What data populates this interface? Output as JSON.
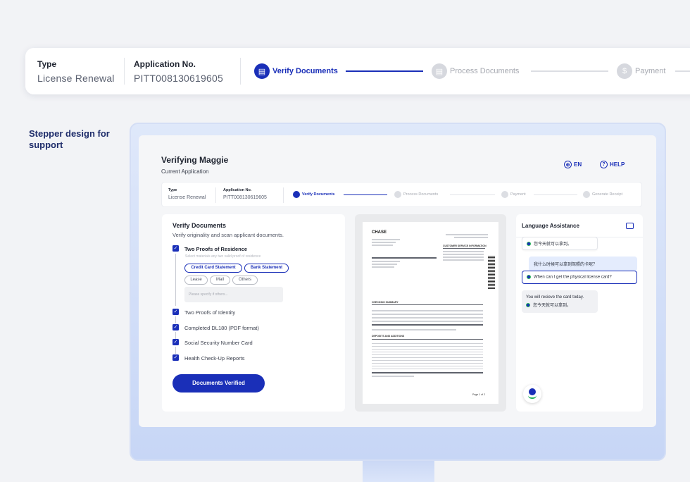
{
  "top_bar": {
    "type_label": "Type",
    "type_value": "License Renewal",
    "app_label": "Application No.",
    "app_value": "PITT008130619605",
    "steps": [
      {
        "label": "Verify Documents",
        "state": "active"
      },
      {
        "label": "Process Documents",
        "state": "inactive"
      },
      {
        "label": "Payment",
        "state": "inactive"
      }
    ]
  },
  "caption": "Stepper design for support",
  "screen": {
    "title": "Verifying Maggie",
    "subtitle": "Current Application",
    "language": "EN",
    "help": "HELP",
    "stepper": {
      "type_label": "Type",
      "type_value": "License Renewal",
      "app_label": "Application No.",
      "app_value": "PITT008130619605",
      "steps": [
        "Verify Documents",
        "Process Documents",
        "Payment",
        "Generate Receipt"
      ]
    },
    "verify": {
      "title": "Verify Documents",
      "subtitle": "Verify originality and scan applicant documents.",
      "item1": "Two Proofs of Residence",
      "hint": "Select materials any two valid proof of residence",
      "chips": [
        "Credit Card Statement",
        "Bank Statement",
        "Lease",
        "Mail",
        "Others"
      ],
      "specify_placeholder": "Please specify if others...",
      "items": [
        "Two Proofs of Identity",
        "Completed DL180 (PDF format)",
        "Social Security Number Card",
        "Health Check-Up Reports"
      ],
      "button": "Documents Verified"
    },
    "document": {
      "bank": "CHASE",
      "customer_info": "CUSTOMER SERVICE INFORMATION",
      "summary": "CHECKING SUMMARY",
      "deposits": "DEPOSITS AND ADDITIONS",
      "page": "Page 1 of 2"
    },
    "chat": {
      "title": "Language Assistance",
      "messages": [
        {
          "role": "agent",
          "text": "您今天就可以拿到。"
        },
        {
          "role": "user",
          "text": "我什么时候可以拿到驾照的卡呢？"
        },
        {
          "role": "translation",
          "text": "When can I get the physical license card?"
        },
        {
          "role": "reply",
          "text": "You will recieve the card today."
        },
        {
          "role": "reply_translation",
          "text": "您今天就可以拿到。"
        }
      ]
    }
  },
  "colors": {
    "accent": "#1a2fb8",
    "success": "#25b35a",
    "monitor": "#c7d6f6"
  }
}
